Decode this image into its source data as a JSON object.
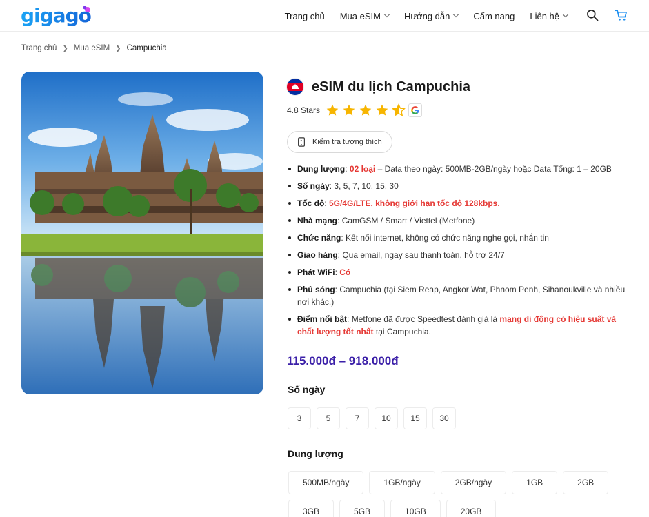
{
  "header": {
    "logo": "gigago",
    "nav": [
      {
        "label": "Trang chủ",
        "has_dropdown": false
      },
      {
        "label": "Mua eSIM",
        "has_dropdown": true
      },
      {
        "label": "Hướng dẫn",
        "has_dropdown": true
      },
      {
        "label": "Cẩm nang",
        "has_dropdown": false
      },
      {
        "label": "Liên hệ",
        "has_dropdown": true
      }
    ],
    "icons": [
      "search-icon",
      "cart-icon"
    ]
  },
  "breadcrumb": [
    "Trang chủ",
    "Mua eSIM",
    "Campuchia"
  ],
  "product": {
    "title": "eSIM du lịch Campuchia",
    "flag_icon": "cambodia-flag-icon",
    "rating_label": "4.8 Stars",
    "rating_value": 4.8,
    "rating_max": 5,
    "check_button": "Kiểm tra tương thích",
    "features": [
      {
        "label": "Dung lượng",
        "highlight": "02 loại",
        "text": " – Data theo ngày: 500MB-2GB/ngày hoặc Data Tổng: 1 – 20GB"
      },
      {
        "label": "Số ngày",
        "text": "3, 5, 7, 10, 15, 30"
      },
      {
        "label": "Tốc độ",
        "highlight": "5G/4G/LTE, không giới hạn tốc độ 128kbps."
      },
      {
        "label": "Nhà mạng",
        "text": "CamGSM / Smart / Viettel (Metfone)"
      },
      {
        "label": "Chức năng",
        "text": "Kết nối internet, không có chức năng nghe gọi, nhắn tin"
      },
      {
        "label": "Giao hàng",
        "text": "Qua email, ngay sau thanh toán, hỗ trợ 24/7"
      },
      {
        "label": "Phát WiFi",
        "highlight": "Có"
      },
      {
        "label": "Phủ sóng",
        "text": "Campuchia (tại Siem Reap, Angkor Wat, Phnom Penh, Sihanoukville và nhiều nơi khác.)"
      },
      {
        "label": "Điểm nổi bật",
        "text": "Metfone đã được Speedtest đánh giá là ",
        "highlight": "mạng di động có hiệu suất và chất lượng tốt nhất",
        "text_after": " tại Campuchia."
      }
    ],
    "price": "115.000đ – 918.000đ",
    "days_label": "Số ngày",
    "days": [
      "3",
      "5",
      "7",
      "10",
      "15",
      "30"
    ],
    "capacity_label": "Dung lượng",
    "capacity_row1": [
      "500MB/ngày",
      "1GB/ngày",
      "2GB/ngày",
      "1GB",
      "2GB"
    ],
    "capacity_row2": [
      "3GB",
      "5GB",
      "10GB",
      "20GB"
    ]
  },
  "colors": {
    "brand_blue": "#1d8ff0",
    "price_purple": "#3b1fa8",
    "highlight_red": "#e53935",
    "star_yellow": "#f7b500"
  }
}
